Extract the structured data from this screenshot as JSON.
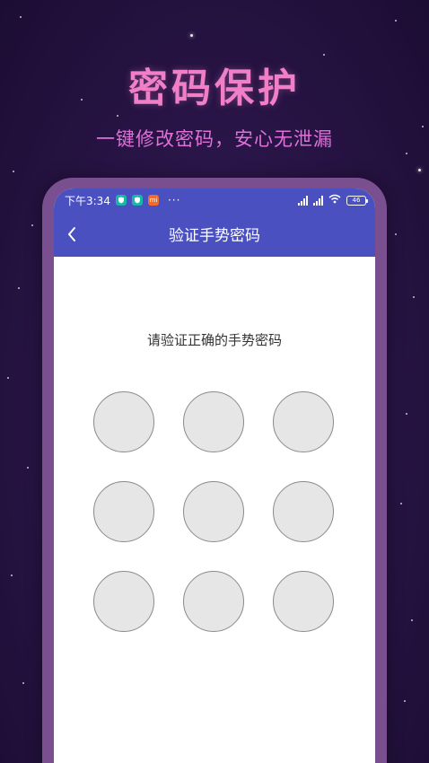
{
  "hero": {
    "title": "密码保护",
    "subtitle": "一键修改密码，安心无泄漏"
  },
  "status_bar": {
    "time": "下午3:34",
    "app_icons": [
      "shield-app-icon",
      "shield-app-icon",
      "mi-app-icon"
    ],
    "mi_label": "mi",
    "more": "···",
    "battery": "46"
  },
  "app": {
    "nav_title": "验证手势密码",
    "back_icon": "chevron-left-icon",
    "prompt": "请验证正确的手势密码",
    "gesture_points": 9
  },
  "colors": {
    "background": "#2a1548",
    "accent_pink": "#f07fc8",
    "header_blue": "#4b50c0",
    "frame": "#7a4f8f",
    "dot_fill": "#e6e6e6",
    "dot_border": "#8a8a8a"
  }
}
